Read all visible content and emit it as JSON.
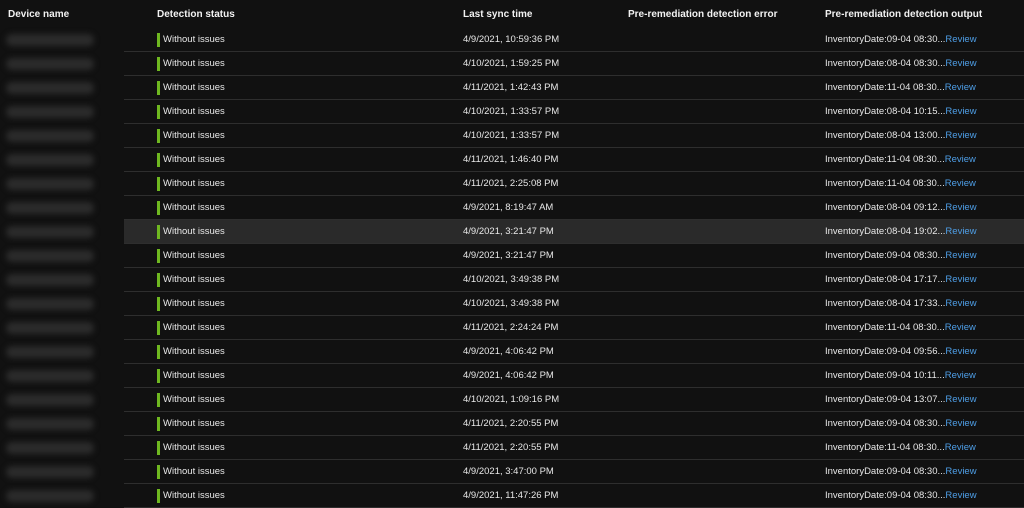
{
  "columns": {
    "device": "Device name",
    "status": "Detection status",
    "sync": "Last sync time",
    "error": "Pre-remediation detection error",
    "output": "Pre-remediation detection output"
  },
  "colors": {
    "status_ok": "#6fb820",
    "link": "#4e9ee6",
    "row_highlight": "#2a2a2a"
  },
  "highlighted_row": 8,
  "rows": [
    {
      "status": "Without issues",
      "sync": "4/9/2021, 10:59:36 PM",
      "output": "InventoryDate:09-04 08:30...",
      "link": "Review"
    },
    {
      "status": "Without issues",
      "sync": "4/10/2021, 1:59:25 PM",
      "output": "InventoryDate:08-04 08:30...",
      "link": "Review"
    },
    {
      "status": "Without issues",
      "sync": "4/11/2021, 1:42:43 PM",
      "output": "InventoryDate:11-04 08:30...",
      "link": "Review"
    },
    {
      "status": "Without issues",
      "sync": "4/10/2021, 1:33:57 PM",
      "output": "InventoryDate:08-04 10:15...",
      "link": "Review"
    },
    {
      "status": "Without issues",
      "sync": "4/10/2021, 1:33:57 PM",
      "output": "InventoryDate:08-04 13:00...",
      "link": "Review"
    },
    {
      "status": "Without issues",
      "sync": "4/11/2021, 1:46:40 PM",
      "output": "InventoryDate:11-04 08:30...",
      "link": "Review"
    },
    {
      "status": "Without issues",
      "sync": "4/11/2021, 2:25:08 PM",
      "output": "InventoryDate:11-04 08:30...",
      "link": "Review"
    },
    {
      "status": "Without issues",
      "sync": "4/9/2021, 8:19:47 AM",
      "output": "InventoryDate:08-04 09:12...",
      "link": "Review"
    },
    {
      "status": "Without issues",
      "sync": "4/9/2021, 3:21:47 PM",
      "output": "InventoryDate:08-04 19:02...",
      "link": "Review"
    },
    {
      "status": "Without issues",
      "sync": "4/9/2021, 3:21:47 PM",
      "output": "InventoryDate:09-04 08:30...",
      "link": "Review"
    },
    {
      "status": "Without issues",
      "sync": "4/10/2021, 3:49:38 PM",
      "output": "InventoryDate:08-04 17:17...",
      "link": "Review"
    },
    {
      "status": "Without issues",
      "sync": "4/10/2021, 3:49:38 PM",
      "output": "InventoryDate:08-04 17:33...",
      "link": "Review"
    },
    {
      "status": "Without issues",
      "sync": "4/11/2021, 2:24:24 PM",
      "output": "InventoryDate:11-04 08:30...",
      "link": "Review"
    },
    {
      "status": "Without issues",
      "sync": "4/9/2021, 4:06:42 PM",
      "output": "InventoryDate:09-04 09:56...",
      "link": "Review"
    },
    {
      "status": "Without issues",
      "sync": "4/9/2021, 4:06:42 PM",
      "output": "InventoryDate:09-04 10:11...",
      "link": "Review"
    },
    {
      "status": "Without issues",
      "sync": "4/10/2021, 1:09:16 PM",
      "output": "InventoryDate:09-04 13:07...",
      "link": "Review"
    },
    {
      "status": "Without issues",
      "sync": "4/11/2021, 2:20:55 PM",
      "output": "InventoryDate:09-04 08:30...",
      "link": "Review"
    },
    {
      "status": "Without issues",
      "sync": "4/11/2021, 2:20:55 PM",
      "output": "InventoryDate:11-04 08:30...",
      "link": "Review"
    },
    {
      "status": "Without issues",
      "sync": "4/9/2021, 3:47:00 PM",
      "output": "InventoryDate:09-04 08:30...",
      "link": "Review"
    },
    {
      "status": "Without issues",
      "sync": "4/9/2021, 11:47:26 PM",
      "output": "InventoryDate:09-04 08:30...",
      "link": "Review"
    }
  ]
}
